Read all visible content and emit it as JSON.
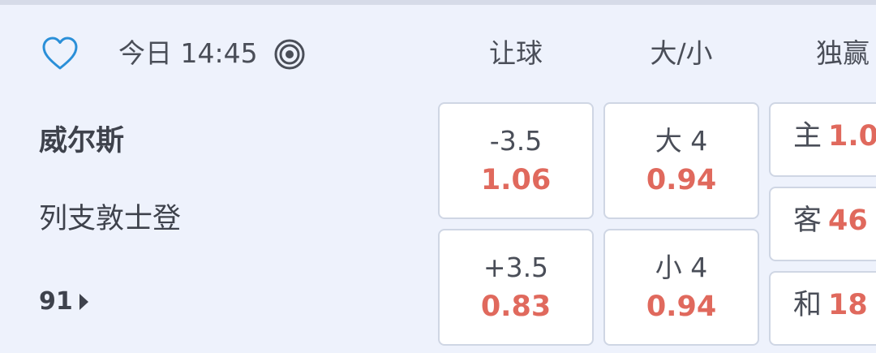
{
  "match": {
    "time": "今日 14:45",
    "home_team": "威尔斯",
    "away_team": "列支敦士登",
    "more_markets": "91"
  },
  "columns": {
    "handicap": "让球",
    "over_under": "大/小",
    "moneyline": "独赢"
  },
  "handicap": {
    "home": {
      "line": "-3.5",
      "odds": "1.06"
    },
    "away": {
      "line": "+3.5",
      "odds": "0.83"
    }
  },
  "over_under": {
    "over": {
      "line": "大 4",
      "odds": "0.94"
    },
    "under": {
      "line": "小 4",
      "odds": "0.94"
    }
  },
  "moneyline": {
    "home": {
      "label": "主",
      "odds": "1.0"
    },
    "away": {
      "label": "客",
      "odds": "46"
    },
    "draw": {
      "label": "和",
      "odds": "18"
    }
  },
  "icons": {
    "favorite": "heart-outline-icon",
    "live": "live-target-icon",
    "more": "triangle-right-icon"
  },
  "colors": {
    "odds": "#e0695d",
    "accent": "#2a8fd8",
    "background": "#eef2fc"
  }
}
